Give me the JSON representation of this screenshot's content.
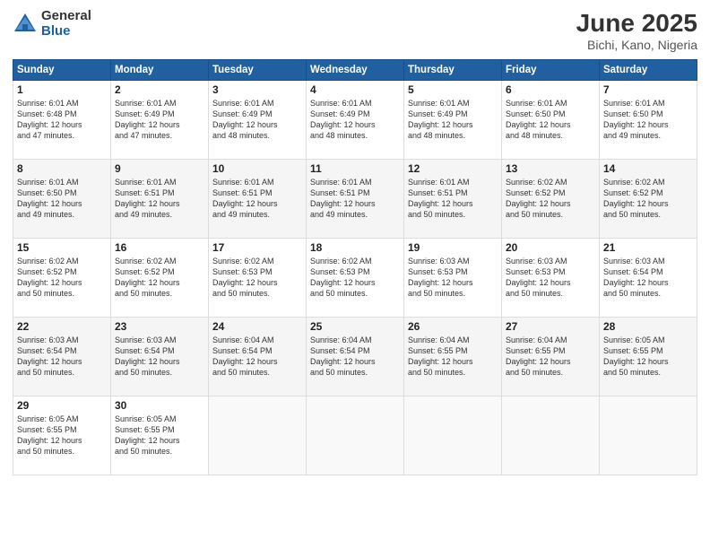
{
  "header": {
    "logo_general": "General",
    "logo_blue": "Blue",
    "title": "June 2025",
    "location": "Bichi, Kano, Nigeria"
  },
  "days_of_week": [
    "Sunday",
    "Monday",
    "Tuesday",
    "Wednesday",
    "Thursday",
    "Friday",
    "Saturday"
  ],
  "weeks": [
    [
      {
        "day": "1",
        "info": "Sunrise: 6:01 AM\nSunset: 6:48 PM\nDaylight: 12 hours\nand 47 minutes."
      },
      {
        "day": "2",
        "info": "Sunrise: 6:01 AM\nSunset: 6:49 PM\nDaylight: 12 hours\nand 47 minutes."
      },
      {
        "day": "3",
        "info": "Sunrise: 6:01 AM\nSunset: 6:49 PM\nDaylight: 12 hours\nand 48 minutes."
      },
      {
        "day": "4",
        "info": "Sunrise: 6:01 AM\nSunset: 6:49 PM\nDaylight: 12 hours\nand 48 minutes."
      },
      {
        "day": "5",
        "info": "Sunrise: 6:01 AM\nSunset: 6:49 PM\nDaylight: 12 hours\nand 48 minutes."
      },
      {
        "day": "6",
        "info": "Sunrise: 6:01 AM\nSunset: 6:50 PM\nDaylight: 12 hours\nand 48 minutes."
      },
      {
        "day": "7",
        "info": "Sunrise: 6:01 AM\nSunset: 6:50 PM\nDaylight: 12 hours\nand 49 minutes."
      }
    ],
    [
      {
        "day": "8",
        "info": "Sunrise: 6:01 AM\nSunset: 6:50 PM\nDaylight: 12 hours\nand 49 minutes."
      },
      {
        "day": "9",
        "info": "Sunrise: 6:01 AM\nSunset: 6:51 PM\nDaylight: 12 hours\nand 49 minutes."
      },
      {
        "day": "10",
        "info": "Sunrise: 6:01 AM\nSunset: 6:51 PM\nDaylight: 12 hours\nand 49 minutes."
      },
      {
        "day": "11",
        "info": "Sunrise: 6:01 AM\nSunset: 6:51 PM\nDaylight: 12 hours\nand 49 minutes."
      },
      {
        "day": "12",
        "info": "Sunrise: 6:01 AM\nSunset: 6:51 PM\nDaylight: 12 hours\nand 50 minutes."
      },
      {
        "day": "13",
        "info": "Sunrise: 6:02 AM\nSunset: 6:52 PM\nDaylight: 12 hours\nand 50 minutes."
      },
      {
        "day": "14",
        "info": "Sunrise: 6:02 AM\nSunset: 6:52 PM\nDaylight: 12 hours\nand 50 minutes."
      }
    ],
    [
      {
        "day": "15",
        "info": "Sunrise: 6:02 AM\nSunset: 6:52 PM\nDaylight: 12 hours\nand 50 minutes."
      },
      {
        "day": "16",
        "info": "Sunrise: 6:02 AM\nSunset: 6:52 PM\nDaylight: 12 hours\nand 50 minutes."
      },
      {
        "day": "17",
        "info": "Sunrise: 6:02 AM\nSunset: 6:53 PM\nDaylight: 12 hours\nand 50 minutes."
      },
      {
        "day": "18",
        "info": "Sunrise: 6:02 AM\nSunset: 6:53 PM\nDaylight: 12 hours\nand 50 minutes."
      },
      {
        "day": "19",
        "info": "Sunrise: 6:03 AM\nSunset: 6:53 PM\nDaylight: 12 hours\nand 50 minutes."
      },
      {
        "day": "20",
        "info": "Sunrise: 6:03 AM\nSunset: 6:53 PM\nDaylight: 12 hours\nand 50 minutes."
      },
      {
        "day": "21",
        "info": "Sunrise: 6:03 AM\nSunset: 6:54 PM\nDaylight: 12 hours\nand 50 minutes."
      }
    ],
    [
      {
        "day": "22",
        "info": "Sunrise: 6:03 AM\nSunset: 6:54 PM\nDaylight: 12 hours\nand 50 minutes."
      },
      {
        "day": "23",
        "info": "Sunrise: 6:03 AM\nSunset: 6:54 PM\nDaylight: 12 hours\nand 50 minutes."
      },
      {
        "day": "24",
        "info": "Sunrise: 6:04 AM\nSunset: 6:54 PM\nDaylight: 12 hours\nand 50 minutes."
      },
      {
        "day": "25",
        "info": "Sunrise: 6:04 AM\nSunset: 6:54 PM\nDaylight: 12 hours\nand 50 minutes."
      },
      {
        "day": "26",
        "info": "Sunrise: 6:04 AM\nSunset: 6:55 PM\nDaylight: 12 hours\nand 50 minutes."
      },
      {
        "day": "27",
        "info": "Sunrise: 6:04 AM\nSunset: 6:55 PM\nDaylight: 12 hours\nand 50 minutes."
      },
      {
        "day": "28",
        "info": "Sunrise: 6:05 AM\nSunset: 6:55 PM\nDaylight: 12 hours\nand 50 minutes."
      }
    ],
    [
      {
        "day": "29",
        "info": "Sunrise: 6:05 AM\nSunset: 6:55 PM\nDaylight: 12 hours\nand 50 minutes."
      },
      {
        "day": "30",
        "info": "Sunrise: 6:05 AM\nSunset: 6:55 PM\nDaylight: 12 hours\nand 50 minutes."
      },
      {
        "day": "",
        "info": ""
      },
      {
        "day": "",
        "info": ""
      },
      {
        "day": "",
        "info": ""
      },
      {
        "day": "",
        "info": ""
      },
      {
        "day": "",
        "info": ""
      }
    ]
  ]
}
